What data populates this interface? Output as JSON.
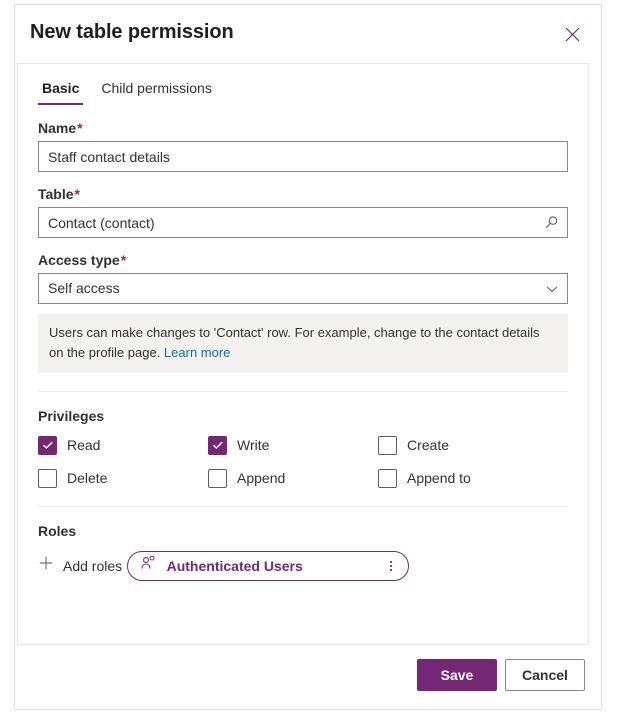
{
  "dialog": {
    "title": "New table permission",
    "close_icon": "close-icon"
  },
  "tabs": [
    {
      "label": "Basic",
      "active": true
    },
    {
      "label": "Child permissions",
      "active": false
    }
  ],
  "fields": {
    "name": {
      "label": "Name",
      "required": "*",
      "value": "Staff contact details",
      "placeholder": ""
    },
    "table": {
      "label": "Table",
      "required": "*",
      "value": "Contact (contact)",
      "placeholder": "",
      "icon": "search-icon"
    },
    "access_type": {
      "label": "Access type",
      "required": "*",
      "value": "Self access",
      "icon": "chevron-down-icon",
      "options": [
        "Self access"
      ]
    }
  },
  "info": {
    "text": "Users can make changes to 'Contact' row. For example, change to the contact details on the profile page. ",
    "link_label": "Learn more"
  },
  "privileges": {
    "title": "Privileges",
    "items": [
      {
        "label": "Read",
        "checked": true
      },
      {
        "label": "Write",
        "checked": true
      },
      {
        "label": "Create",
        "checked": false
      },
      {
        "label": "Delete",
        "checked": false
      },
      {
        "label": "Append",
        "checked": false
      },
      {
        "label": "Append to",
        "checked": false
      }
    ]
  },
  "roles": {
    "title": "Roles",
    "add_label": "Add roles",
    "add_icon": "plus-icon",
    "chips": [
      {
        "label": "Authenticated Users",
        "icon": "person-role-icon",
        "menu_icon": "more-vertical-icon"
      }
    ]
  },
  "footer": {
    "save_label": "Save",
    "cancel_label": "Cancel"
  },
  "colors": {
    "accent": "#742774",
    "link": "#0f6cbd",
    "required": "#a4262c",
    "info_bg": "#f3f2f1"
  }
}
